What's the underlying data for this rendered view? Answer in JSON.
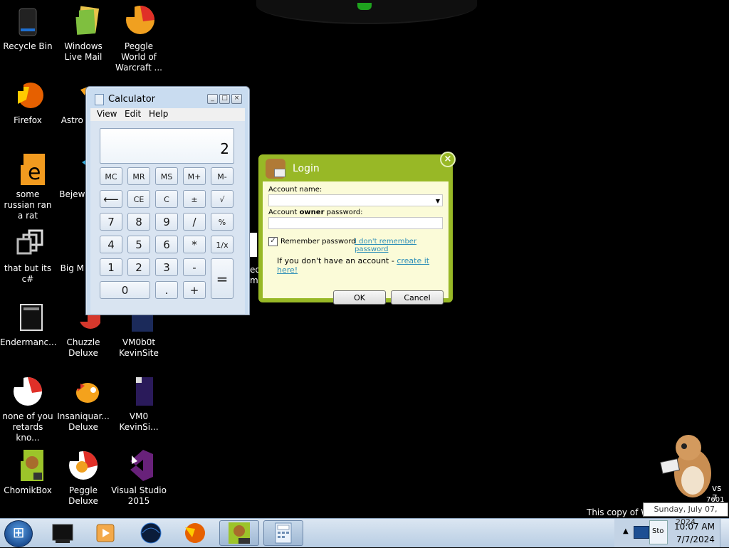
{
  "desktop": {
    "icons": [
      {
        "id": "recycle-bin",
        "label": "Recycle Bin",
        "icon": "recycle-bin-icon"
      },
      {
        "id": "windows-live-mail",
        "label": "Windows Live Mail",
        "icon": "mail-icon"
      },
      {
        "id": "peggle-world-of-warcraft",
        "label": "Peggle World of Warcraft ...",
        "icon": "peggle-icon"
      },
      {
        "id": "firefox",
        "label": "Firefox",
        "icon": "firefox-icon"
      },
      {
        "id": "astro",
        "label": "Astro Delu",
        "icon": "astro-icon"
      },
      {
        "id": "some-russian",
        "label": "some russian ran a rat",
        "icon": "file-icon"
      },
      {
        "id": "bejeweled",
        "label": "Bejew Delu",
        "icon": "bejeweled-icon"
      },
      {
        "id": "that-but",
        "label": "that but its c#",
        "icon": "shortcut-icon"
      },
      {
        "id": "big-m",
        "label": "Big M Delu",
        "icon": "game-icon"
      },
      {
        "id": "endermanc",
        "label": "Endermanc...",
        "icon": "app-icon"
      },
      {
        "id": "chuzzle",
        "label": "Chuzzle Deluxe",
        "icon": "chuzzle-icon"
      },
      {
        "id": "vm0b0t-kevinsite",
        "label": "VM0b0t KevinSite",
        "icon": "vm-icon"
      },
      {
        "id": "none-of-you",
        "label": "none of you retards kno...",
        "icon": "peggle-icon"
      },
      {
        "id": "insaniquarium",
        "label": "Insaniquar... Deluxe",
        "icon": "fish-icon"
      },
      {
        "id": "vm0-kevinsi",
        "label": "VM0 KevinSi...",
        "icon": "vm-icon"
      },
      {
        "id": "chomikbox",
        "label": "ChomikBox",
        "icon": "chomikbox-icon"
      },
      {
        "id": "peggle-deluxe",
        "label": "Peggle Deluxe",
        "icon": "peggle-icon"
      },
      {
        "id": "visual-studio-2015",
        "label": "Visual Studio 2015",
        "icon": "visual-studio-icon"
      }
    ],
    "partial_label": "eo m",
    "watermark_line1": "This copy of W",
    "watermark_side1": "vs 7",
    "watermark_side2": "7601"
  },
  "calculator": {
    "title": "Calculator",
    "menu": [
      "View",
      "Edit",
      "Help"
    ],
    "display": "2",
    "buttons": {
      "mc": "MC",
      "mr": "MR",
      "ms": "MS",
      "mplus": "M+",
      "mminus": "M-",
      "back": "⟵",
      "ce": "CE",
      "c": "C",
      "pm": "±",
      "sqrt": "√",
      "n7": "7",
      "n8": "8",
      "n9": "9",
      "div": "/",
      "pct": "%",
      "n4": "4",
      "n5": "5",
      "n6": "6",
      "mul": "*",
      "inv": "1/x",
      "n1": "1",
      "n2": "2",
      "n3": "3",
      "sub": "-",
      "eq": "=",
      "n0": "0",
      "dot": ".",
      "add": "+"
    }
  },
  "login": {
    "title": "Login",
    "close": "×",
    "account_name_label": "Account name:",
    "account_name_value": "",
    "password_label_pre": "Account ",
    "password_label_bold": "owner",
    "password_label_post": " password:",
    "password_value": "",
    "remember_label": "Remember password",
    "remember_checked": true,
    "forgot_link": "I don't remember password",
    "no_account_text": "If you don't have an account - ",
    "create_link": "create it here!",
    "ok": "OK",
    "cancel": "Cancel"
  },
  "taskbar": {
    "tooltip": "Sunday, July 07, 2024",
    "time": "10:07 AM",
    "date": "7/7/2024",
    "tray_label": "Sto"
  },
  "colors": {
    "login_green": "#98b826",
    "taskbar": "#c8d8ea",
    "desktop": "#000000"
  }
}
